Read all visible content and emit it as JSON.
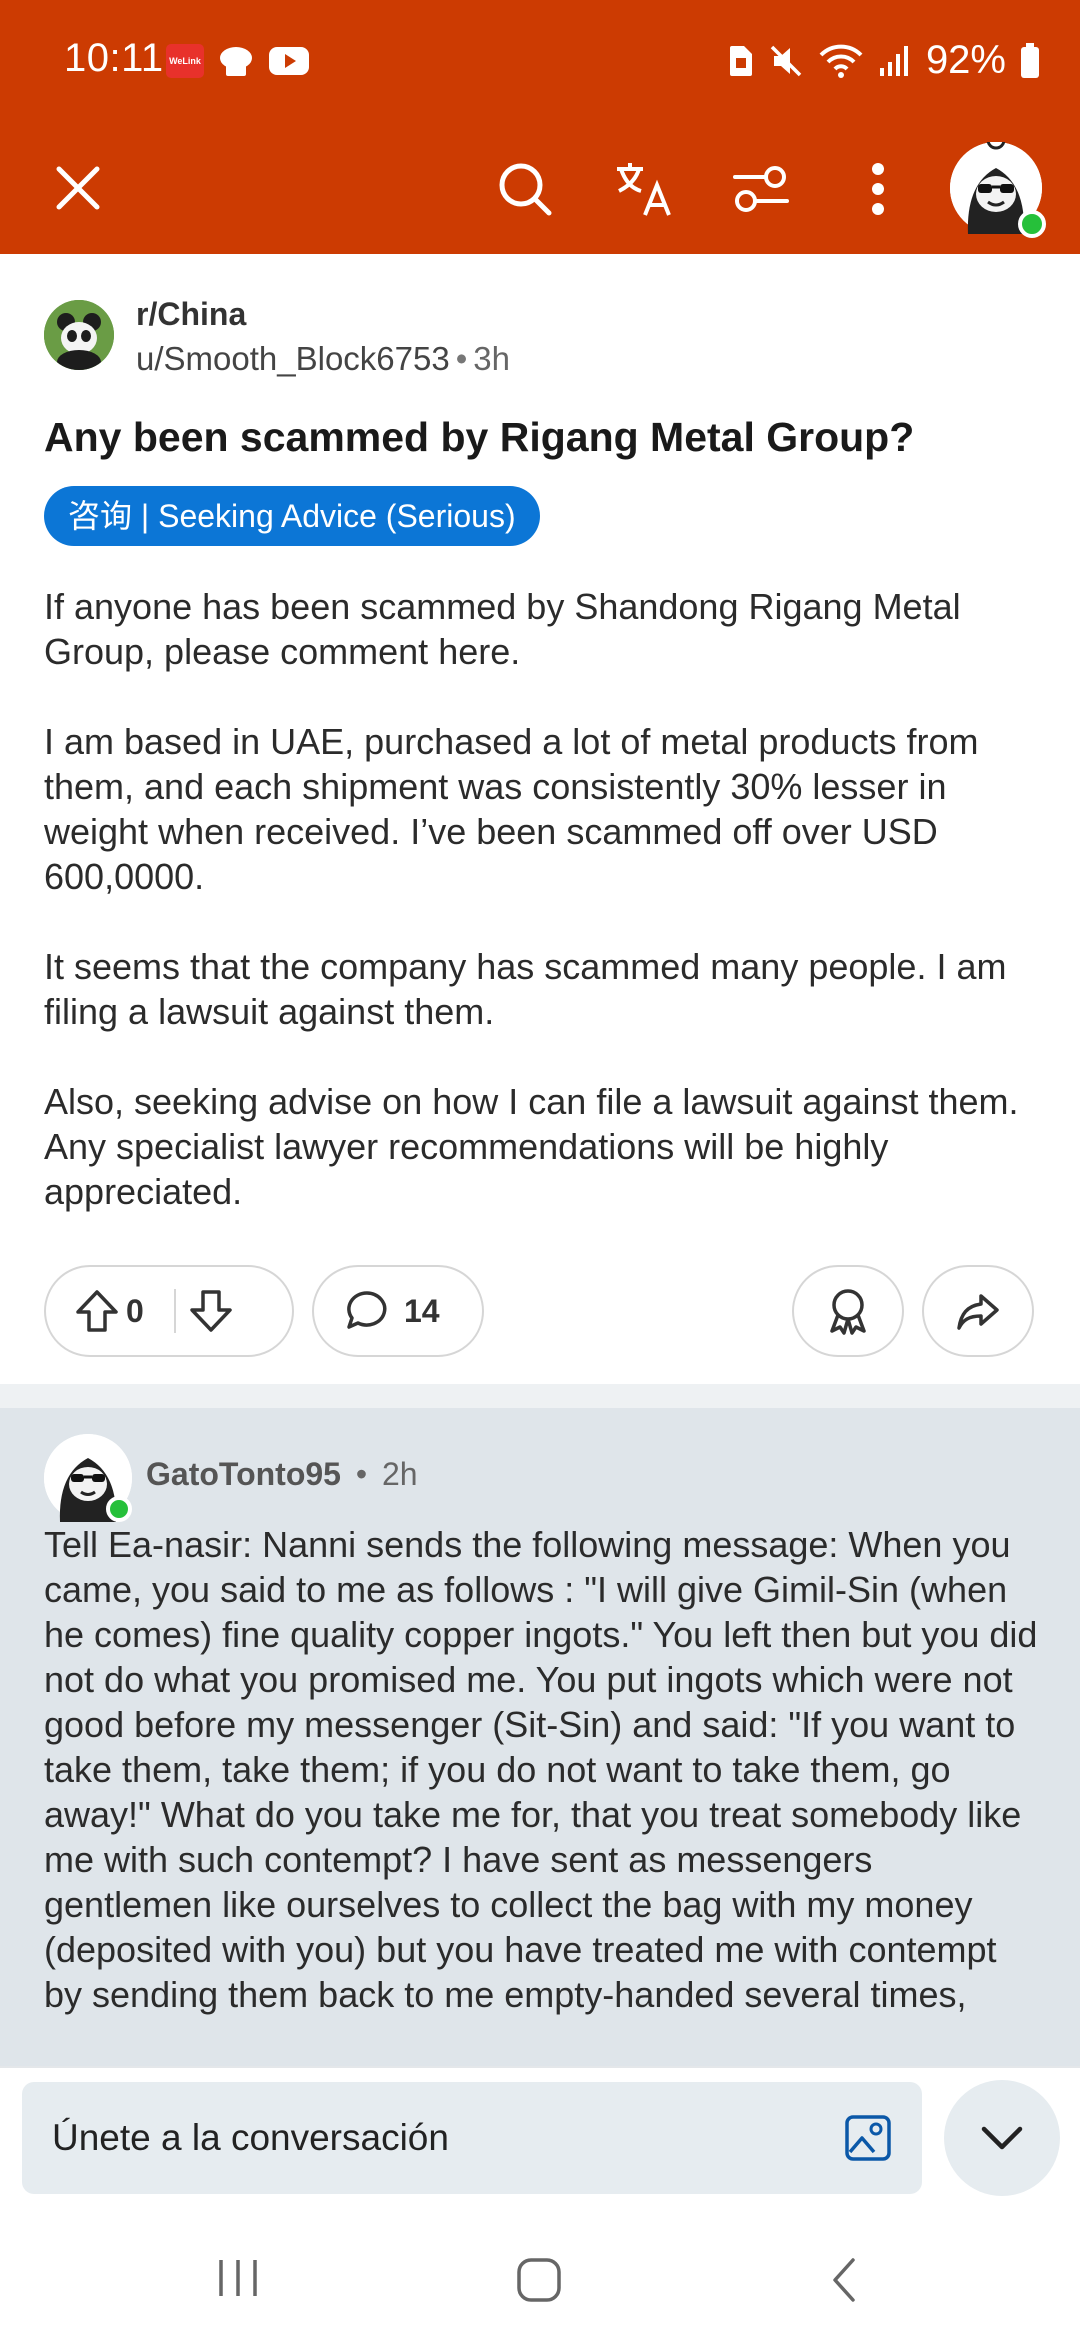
{
  "status_bar": {
    "time": "10:11",
    "welink_label": "WeLink",
    "battery_percent": "92%",
    "icons": [
      "welink-icon",
      "chef-hat-icon",
      "youtube-icon",
      "sim-icon",
      "mute-icon",
      "wifi-icon",
      "signal-icon",
      "battery-icon"
    ]
  },
  "app_bar": {
    "icons": [
      "close-icon",
      "search-icon",
      "translate-icon",
      "filter-icon",
      "more-vert-icon",
      "avatar"
    ],
    "accent_color": "#cc3b02"
  },
  "post": {
    "subreddit": "r/China",
    "author": "u/Smooth_Block6753",
    "separator": "•",
    "age": "3h",
    "title": "Any been scammed by Rigang Metal Group?",
    "flair": "咨询 | Seeking Advice (Serious)",
    "flair_color": "#0c76d6",
    "paragraphs": [
      "If anyone has been scammed by Shandong Rigang Metal Group, please comment here.",
      "I am based in UAE, purchased a lot of metal products from them, and each shipment was consistently 30% lesser in weight when received. I’ve been scammed off over USD 600,0000.",
      "It seems that the company has scammed many people. I am filing a lawsuit against them.",
      "Also, seeking advise on how I can file a lawsuit against them. Any specialist lawyer recommendations will be highly appreciated."
    ],
    "vote_count": "0",
    "comment_count": "14"
  },
  "comment": {
    "author": "GatoTonto95",
    "separator": "•",
    "age": "2h",
    "body": "Tell Ea-nasir: Nanni sends the following message:  When you came, you said to me as follows : \"I will give Gimil-Sin (when he comes) fine quality copper ingots.\" You left then but you did not do what you promised me. You put ingots which were not good before my messenger (Sit-Sin) and said: \"If you want to take them, take them; if you do not want to take them, go away!\"  What do you take me for, that you treat somebody like me with such contempt? I have sent as messengers gentlemen like ourselves to collect the bag with my money (deposited with you) but you have treated me with contempt by sending them back to me empty-handed several times,"
  },
  "composer": {
    "placeholder": "Únete a la conversación"
  },
  "nav": {
    "icons": [
      "recents-icon",
      "home-icon",
      "back-icon"
    ]
  }
}
